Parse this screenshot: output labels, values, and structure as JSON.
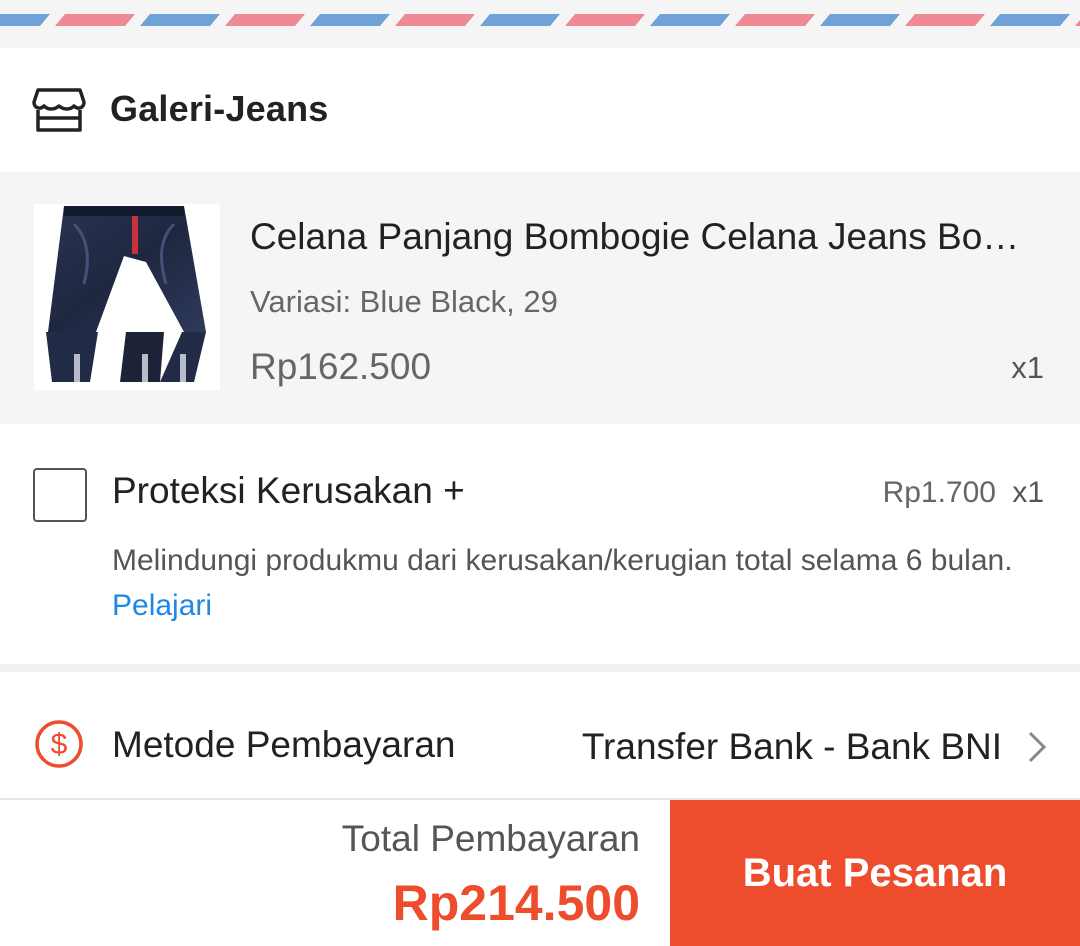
{
  "shop": {
    "name": "Galeri-Jeans",
    "icon": "store-icon"
  },
  "product": {
    "title": "Celana Panjang Bombogie Celana Jeans Bo…",
    "variant": "Variasi: Blue Black, 29",
    "price": "Rp162.500",
    "quantity": "x1",
    "thumbnail": "jeans-thumbnail"
  },
  "protection": {
    "title": "Proteksi Kerusakan +",
    "price": "Rp1.700",
    "quantity": "x1",
    "description": "Melindungi produkmu dari kerusakan/kerugian total selama 6 bulan.",
    "link_label": "Pelajari",
    "checked": false
  },
  "payment": {
    "label": "Metode Pembayaran",
    "method": "Transfer Bank - Bank BNI",
    "icon": "dollar-circle-icon"
  },
  "footer": {
    "total_label": "Total Pembayaran",
    "total_value": "Rp214.500",
    "order_button": "Buat Pesanan"
  },
  "colors": {
    "accent": "#ee4d2d",
    "link": "#1e88e5",
    "airmail_red": "#ef8a94",
    "airmail_blue": "#6fa3d8"
  }
}
